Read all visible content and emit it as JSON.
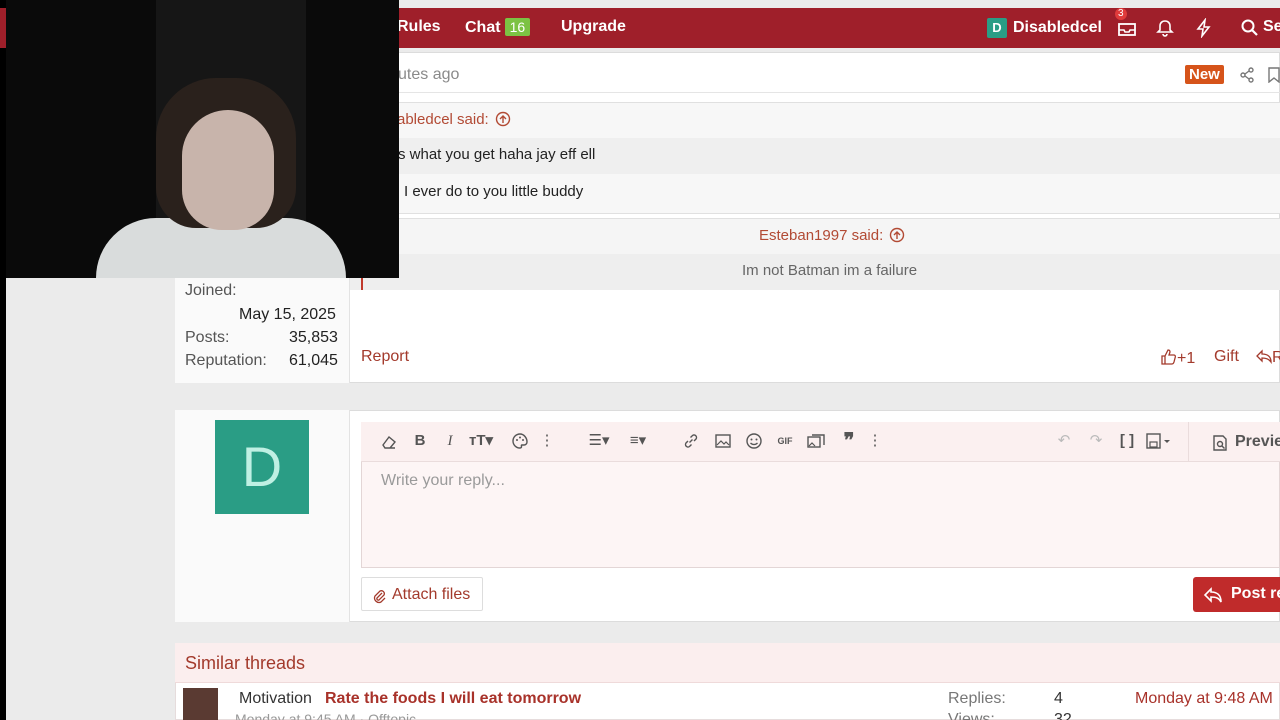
{
  "nav": {
    "rules": "Rules",
    "chat": "Chat",
    "chat_badge": "16",
    "upgrade": "Upgrade",
    "user_initial": "D",
    "username": "Disabledcel",
    "inbox_count": "3",
    "search": "Se"
  },
  "post": {
    "time": "utes ago",
    "new_badge": "New",
    "quote1_author": "abledcel said:",
    "quote1_line1": "s what you get haha jay eff ell",
    "quote1_line2": "I ever do to you little buddy",
    "quote2_author": "Esteban1997 said:",
    "quote2_text": "Im not Batman im a failure",
    "report": "Report",
    "like": "+1",
    "gift": "Gift",
    "reply_short": "R"
  },
  "user_info": {
    "joined_label": "Joined:",
    "joined_value": "May 15, 2025",
    "posts_label": "Posts:",
    "posts_value": "35,853",
    "rep_label": "Reputation:",
    "rep_value": "61,045"
  },
  "reply": {
    "avatar_letter": "D",
    "placeholder": "Write your reply...",
    "attach": "Attach files",
    "preview": "Previe",
    "post_reply": "Post re"
  },
  "similar": {
    "title": "Similar threads",
    "thread_prefix": "Motivation",
    "thread_title": "Rate the foods I will eat tomorrow",
    "thread_sub": "Monday at 9:45 AM · Offtopic",
    "replies_label": "Replies:",
    "replies_value": "4",
    "views_label": "Views:",
    "views_value": "32",
    "date": "Monday at 9:48 AM"
  },
  "colors": {
    "brand": "#9f1f2a",
    "accent_link": "#a33a2c",
    "new_badge": "#d6541a",
    "avatar_bg": "#2a9d85"
  }
}
